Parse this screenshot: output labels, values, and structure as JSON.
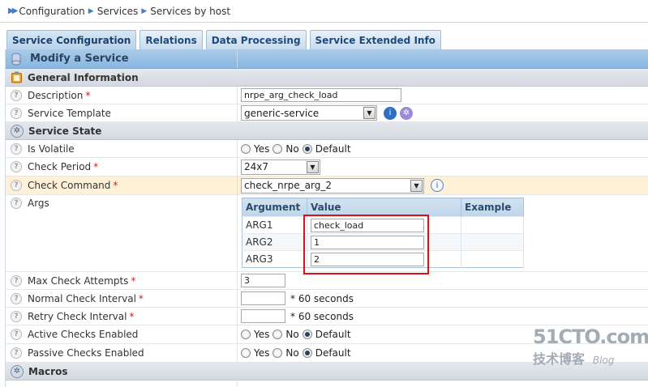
{
  "breadcrumb": [
    "Configuration",
    "Services",
    "Services by host"
  ],
  "tabs": [
    {
      "label": "Service Configuration",
      "active": true
    },
    {
      "label": "Relations"
    },
    {
      "label": "Data Processing"
    },
    {
      "label": "Service Extended Info"
    }
  ],
  "form_title": "Modify a Service",
  "sections": {
    "general": "General Information",
    "state": "Service State",
    "macros": "Macros"
  },
  "fields": {
    "description": {
      "label": "Description",
      "value": "nrpe_arg_check_load"
    },
    "template": {
      "label": "Service Template",
      "value": "generic-service"
    },
    "is_volatile": {
      "label": "Is Volatile"
    },
    "check_period": {
      "label": "Check Period",
      "value": "24x7"
    },
    "check_command": {
      "label": "Check Command",
      "value": "check_nrpe_arg_2"
    },
    "args": {
      "label": "Args"
    },
    "max_check": {
      "label": "Max Check Attempts",
      "value": "3"
    },
    "normal_interval": {
      "label": "Normal Check Interval",
      "unit": "* 60 seconds"
    },
    "retry_interval": {
      "label": "Retry Check Interval",
      "unit": "* 60 seconds"
    },
    "active_checks": {
      "label": "Active Checks Enabled"
    },
    "passive_checks": {
      "label": "Passive Checks Enabled"
    }
  },
  "radio_labels": {
    "yes": "Yes",
    "no": "No",
    "default": "Default"
  },
  "args_table": {
    "headers": [
      "Argument",
      "Value",
      "Example"
    ],
    "rows": [
      {
        "argument": "ARG1",
        "value": "check_load"
      },
      {
        "argument": "ARG2",
        "value": "1"
      },
      {
        "argument": "ARG3",
        "value": "2"
      }
    ]
  },
  "required_mark": "*",
  "help_glyph": "?",
  "watermark": {
    "line1": "51CTO.com",
    "line2": "技术博客",
    "line3": "Blog"
  },
  "colors": {
    "header": "#8ab7df",
    "highlight_row": "#fff1d8",
    "annotation_box": "#d8121a"
  }
}
